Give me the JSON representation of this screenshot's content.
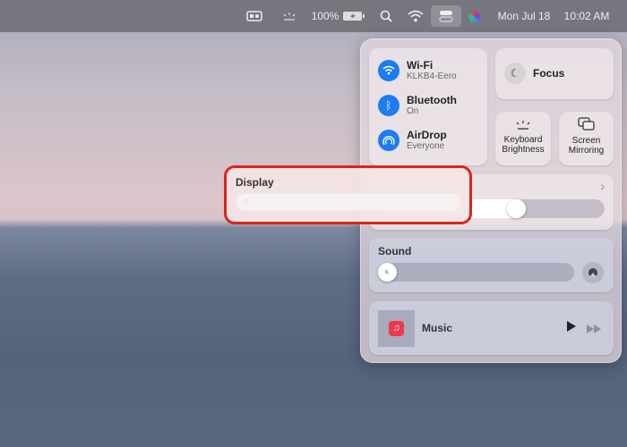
{
  "menubar": {
    "battery": "100%",
    "date": "Mon Jul 18",
    "time": "10:02 AM"
  },
  "network": [
    {
      "label": "Wi-Fi",
      "sub": "KLKB4-Eero"
    },
    {
      "label": "Bluetooth",
      "sub": "On"
    },
    {
      "label": "AirDrop",
      "sub": "Everyone"
    }
  ],
  "focus": {
    "label": "Focus"
  },
  "keyboard": {
    "line1": "Keyboard",
    "line2": "Brightness"
  },
  "mirroring": {
    "line1": "Screen",
    "line2": "Mirroring"
  },
  "display": {
    "label": "Display",
    "brightness_percent": 62
  },
  "sound": {
    "label": "Sound",
    "volume_percent": 0
  },
  "music": {
    "label": "Music"
  },
  "colors": {
    "accent": "#1c7cf2",
    "highlight": "#d9261c"
  }
}
